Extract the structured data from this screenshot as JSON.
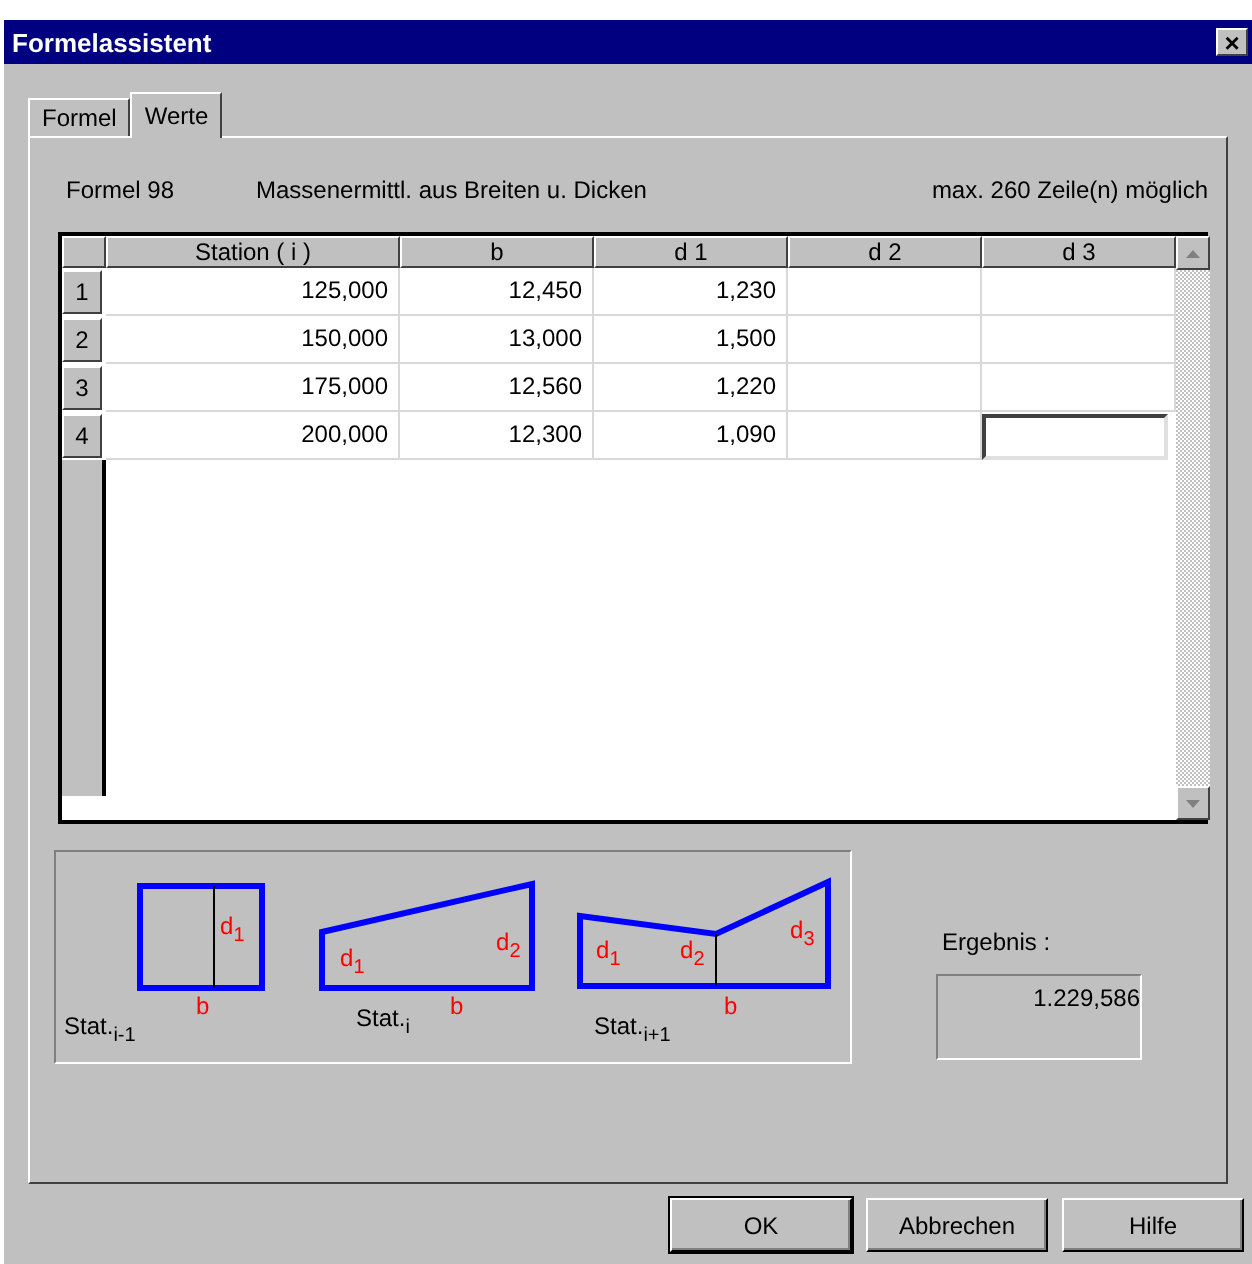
{
  "window": {
    "title": "Formelassistent",
    "close": "×"
  },
  "tabs": [
    {
      "label": "Formel",
      "selected": false
    },
    {
      "label": "Werte",
      "selected": true
    }
  ],
  "header": {
    "formula": "Formel 98",
    "description": "Massenermittl. aus Breiten u. Dicken",
    "limit": "max. 260 Zeile(n) möglich"
  },
  "table": {
    "columns": [
      "Station ( i )",
      "b",
      "d 1",
      "d 2",
      "d 3"
    ],
    "rows": [
      {
        "label": "1",
        "cells": [
          {
            "value": "125,000",
            "focused": false
          },
          {
            "value": "12,450",
            "focused": false
          },
          {
            "value": "1,230",
            "focused": false
          },
          {
            "focused": false
          },
          {
            "focused": false
          }
        ]
      },
      {
        "label": "2",
        "cells": [
          {
            "value": "150,000",
            "focused": false
          },
          {
            "value": "13,000",
            "focused": false
          },
          {
            "value": "1,500",
            "focused": false
          },
          {
            "focused": false
          },
          {
            "focused": false
          }
        ]
      },
      {
        "label": "3",
        "cells": [
          {
            "value": "175,000",
            "focused": false
          },
          {
            "value": "12,560",
            "focused": false
          },
          {
            "value": "1,220",
            "focused": false
          },
          {
            "focused": false
          },
          {
            "focused": false
          }
        ]
      },
      {
        "label": "4",
        "cells": [
          {
            "value": "200,000",
            "focused": false
          },
          {
            "value": "12,300",
            "focused": false
          },
          {
            "value": "1,090",
            "focused": false
          },
          {
            "focused": false
          },
          {
            "focused": true
          }
        ]
      }
    ]
  },
  "diagrams": [
    {
      "kind": "rect",
      "station": "Stat.$_{i-1}$",
      "width_label": "b",
      "depth_labels": [
        "d$_{1}$"
      ]
    },
    {
      "kind": "trapezoid",
      "station": "Stat.$_{i}$",
      "width_label": "b",
      "depth_labels": [
        "d$_{1}$",
        "d$_{2}$"
      ]
    },
    {
      "kind": "double",
      "station": "Stat.$_{i+1}$",
      "width_label": "b",
      "depth_labels": [
        "d$_{1}$",
        "d$_{2}$",
        "d$_{3}$"
      ]
    }
  ],
  "result": {
    "label": "Ergebnis :",
    "value": "1.229,586"
  },
  "buttons": [
    "OK",
    "Abbrechen",
    "Hilfe"
  ]
}
